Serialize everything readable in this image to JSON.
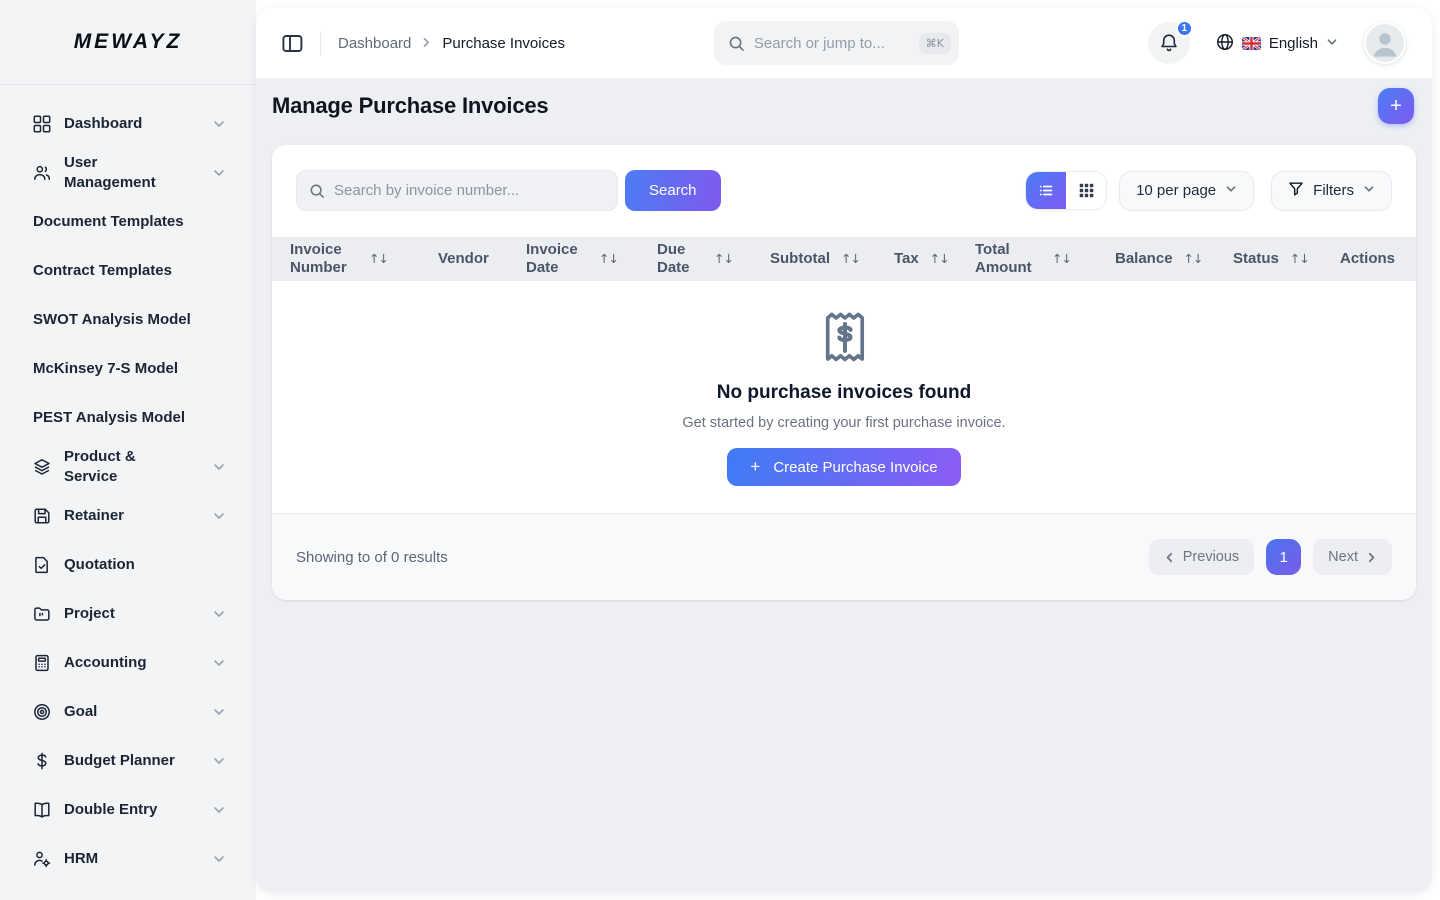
{
  "brand": {
    "name": "MEWAYZ"
  },
  "sidebar": {
    "items": [
      {
        "label": "Dashboard",
        "icon": "grid",
        "expandable": true
      },
      {
        "label": "User Management",
        "icon": "users",
        "expandable": true
      },
      {
        "label": "Document Templates",
        "icon": null,
        "expandable": false
      },
      {
        "label": "Contract Templates",
        "icon": null,
        "expandable": false
      },
      {
        "label": "SWOT Analysis Model",
        "icon": null,
        "expandable": false
      },
      {
        "label": "McKinsey 7-S Model",
        "icon": null,
        "expandable": false
      },
      {
        "label": "PEST Analysis Model",
        "icon": null,
        "expandable": false
      },
      {
        "label": "Product & Service",
        "icon": "layers",
        "expandable": true
      },
      {
        "label": "Retainer",
        "icon": "save",
        "expandable": true
      },
      {
        "label": "Quotation",
        "icon": "file-check",
        "expandable": false
      },
      {
        "label": "Project",
        "icon": "folder",
        "expandable": true
      },
      {
        "label": "Accounting",
        "icon": "calculator",
        "expandable": true
      },
      {
        "label": "Goal",
        "icon": "target",
        "expandable": true
      },
      {
        "label": "Budget Planner",
        "icon": "dollar",
        "expandable": true
      },
      {
        "label": "Double Entry",
        "icon": "book-open",
        "expandable": true
      },
      {
        "label": "HRM",
        "icon": "user-gear",
        "expandable": true
      }
    ]
  },
  "header": {
    "breadcrumb": {
      "parent": "Dashboard",
      "current": "Purchase Invoices"
    },
    "search": {
      "placeholder": "Search or jump to...",
      "shortcut": "⌘K"
    },
    "notifications": {
      "count": "1"
    },
    "language": {
      "label": "English"
    }
  },
  "page": {
    "title": "Manage Purchase Invoices",
    "toolbar": {
      "search_placeholder": "Search by invoice number...",
      "search_button": "Search",
      "per_page": "10 per page",
      "filters": "Filters"
    },
    "table": {
      "columns": [
        {
          "label": "Invoice Number",
          "sortable": true
        },
        {
          "label": "Vendor",
          "sortable": false
        },
        {
          "label": "Invoice Date",
          "sortable": true
        },
        {
          "label": "Due Date",
          "sortable": true
        },
        {
          "label": "Subtotal",
          "sortable": true
        },
        {
          "label": "Tax",
          "sortable": true
        },
        {
          "label": "Total Amount",
          "sortable": true
        },
        {
          "label": "Balance",
          "sortable": true
        },
        {
          "label": "Status",
          "sortable": true
        },
        {
          "label": "Actions",
          "sortable": false
        }
      ],
      "rows": []
    },
    "empty_state": {
      "heading": "No purchase invoices found",
      "subtitle": "Get started by creating your first purchase invoice.",
      "cta": "Create Purchase Invoice"
    },
    "pagination": {
      "summary": "Showing to of 0 results",
      "previous": "Previous",
      "current_page": "1",
      "next": "Next"
    }
  },
  "icons": {
    "sort": "↑↓",
    "plus": "+"
  },
  "colors": {
    "accent_start": "#4a7bf5",
    "accent_end": "#8b5cf6",
    "badge_blue": "#3b74ef"
  }
}
